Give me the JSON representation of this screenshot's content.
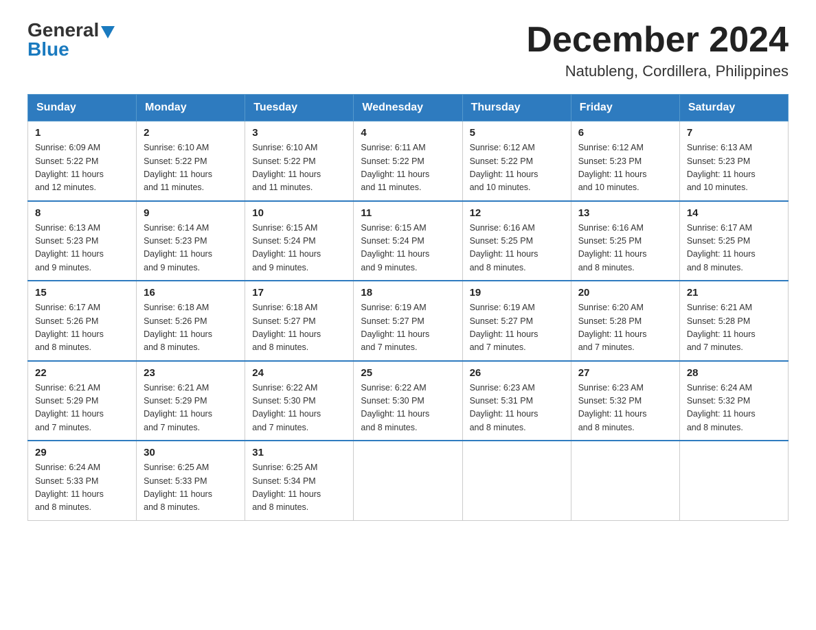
{
  "header": {
    "logo_general": "General",
    "logo_blue": "Blue",
    "month_title": "December 2024",
    "location": "Natubleng, Cordillera, Philippines"
  },
  "days_of_week": [
    "Sunday",
    "Monday",
    "Tuesday",
    "Wednesday",
    "Thursday",
    "Friday",
    "Saturday"
  ],
  "weeks": [
    [
      {
        "day": "1",
        "sunrise": "6:09 AM",
        "sunset": "5:22 PM",
        "daylight": "11 hours and 12 minutes."
      },
      {
        "day": "2",
        "sunrise": "6:10 AM",
        "sunset": "5:22 PM",
        "daylight": "11 hours and 11 minutes."
      },
      {
        "day": "3",
        "sunrise": "6:10 AM",
        "sunset": "5:22 PM",
        "daylight": "11 hours and 11 minutes."
      },
      {
        "day": "4",
        "sunrise": "6:11 AM",
        "sunset": "5:22 PM",
        "daylight": "11 hours and 11 minutes."
      },
      {
        "day": "5",
        "sunrise": "6:12 AM",
        "sunset": "5:22 PM",
        "daylight": "11 hours and 10 minutes."
      },
      {
        "day": "6",
        "sunrise": "6:12 AM",
        "sunset": "5:23 PM",
        "daylight": "11 hours and 10 minutes."
      },
      {
        "day": "7",
        "sunrise": "6:13 AM",
        "sunset": "5:23 PM",
        "daylight": "11 hours and 10 minutes."
      }
    ],
    [
      {
        "day": "8",
        "sunrise": "6:13 AM",
        "sunset": "5:23 PM",
        "daylight": "11 hours and 9 minutes."
      },
      {
        "day": "9",
        "sunrise": "6:14 AM",
        "sunset": "5:23 PM",
        "daylight": "11 hours and 9 minutes."
      },
      {
        "day": "10",
        "sunrise": "6:15 AM",
        "sunset": "5:24 PM",
        "daylight": "11 hours and 9 minutes."
      },
      {
        "day": "11",
        "sunrise": "6:15 AM",
        "sunset": "5:24 PM",
        "daylight": "11 hours and 9 minutes."
      },
      {
        "day": "12",
        "sunrise": "6:16 AM",
        "sunset": "5:25 PM",
        "daylight": "11 hours and 8 minutes."
      },
      {
        "day": "13",
        "sunrise": "6:16 AM",
        "sunset": "5:25 PM",
        "daylight": "11 hours and 8 minutes."
      },
      {
        "day": "14",
        "sunrise": "6:17 AM",
        "sunset": "5:25 PM",
        "daylight": "11 hours and 8 minutes."
      }
    ],
    [
      {
        "day": "15",
        "sunrise": "6:17 AM",
        "sunset": "5:26 PM",
        "daylight": "11 hours and 8 minutes."
      },
      {
        "day": "16",
        "sunrise": "6:18 AM",
        "sunset": "5:26 PM",
        "daylight": "11 hours and 8 minutes."
      },
      {
        "day": "17",
        "sunrise": "6:18 AM",
        "sunset": "5:27 PM",
        "daylight": "11 hours and 8 minutes."
      },
      {
        "day": "18",
        "sunrise": "6:19 AM",
        "sunset": "5:27 PM",
        "daylight": "11 hours and 7 minutes."
      },
      {
        "day": "19",
        "sunrise": "6:19 AM",
        "sunset": "5:27 PM",
        "daylight": "11 hours and 7 minutes."
      },
      {
        "day": "20",
        "sunrise": "6:20 AM",
        "sunset": "5:28 PM",
        "daylight": "11 hours and 7 minutes."
      },
      {
        "day": "21",
        "sunrise": "6:21 AM",
        "sunset": "5:28 PM",
        "daylight": "11 hours and 7 minutes."
      }
    ],
    [
      {
        "day": "22",
        "sunrise": "6:21 AM",
        "sunset": "5:29 PM",
        "daylight": "11 hours and 7 minutes."
      },
      {
        "day": "23",
        "sunrise": "6:21 AM",
        "sunset": "5:29 PM",
        "daylight": "11 hours and 7 minutes."
      },
      {
        "day": "24",
        "sunrise": "6:22 AM",
        "sunset": "5:30 PM",
        "daylight": "11 hours and 7 minutes."
      },
      {
        "day": "25",
        "sunrise": "6:22 AM",
        "sunset": "5:30 PM",
        "daylight": "11 hours and 8 minutes."
      },
      {
        "day": "26",
        "sunrise": "6:23 AM",
        "sunset": "5:31 PM",
        "daylight": "11 hours and 8 minutes."
      },
      {
        "day": "27",
        "sunrise": "6:23 AM",
        "sunset": "5:32 PM",
        "daylight": "11 hours and 8 minutes."
      },
      {
        "day": "28",
        "sunrise": "6:24 AM",
        "sunset": "5:32 PM",
        "daylight": "11 hours and 8 minutes."
      }
    ],
    [
      {
        "day": "29",
        "sunrise": "6:24 AM",
        "sunset": "5:33 PM",
        "daylight": "11 hours and 8 minutes."
      },
      {
        "day": "30",
        "sunrise": "6:25 AM",
        "sunset": "5:33 PM",
        "daylight": "11 hours and 8 minutes."
      },
      {
        "day": "31",
        "sunrise": "6:25 AM",
        "sunset": "5:34 PM",
        "daylight": "11 hours and 8 minutes."
      },
      null,
      null,
      null,
      null
    ]
  ],
  "labels": {
    "sunrise": "Sunrise:",
    "sunset": "Sunset:",
    "daylight": "Daylight:"
  }
}
